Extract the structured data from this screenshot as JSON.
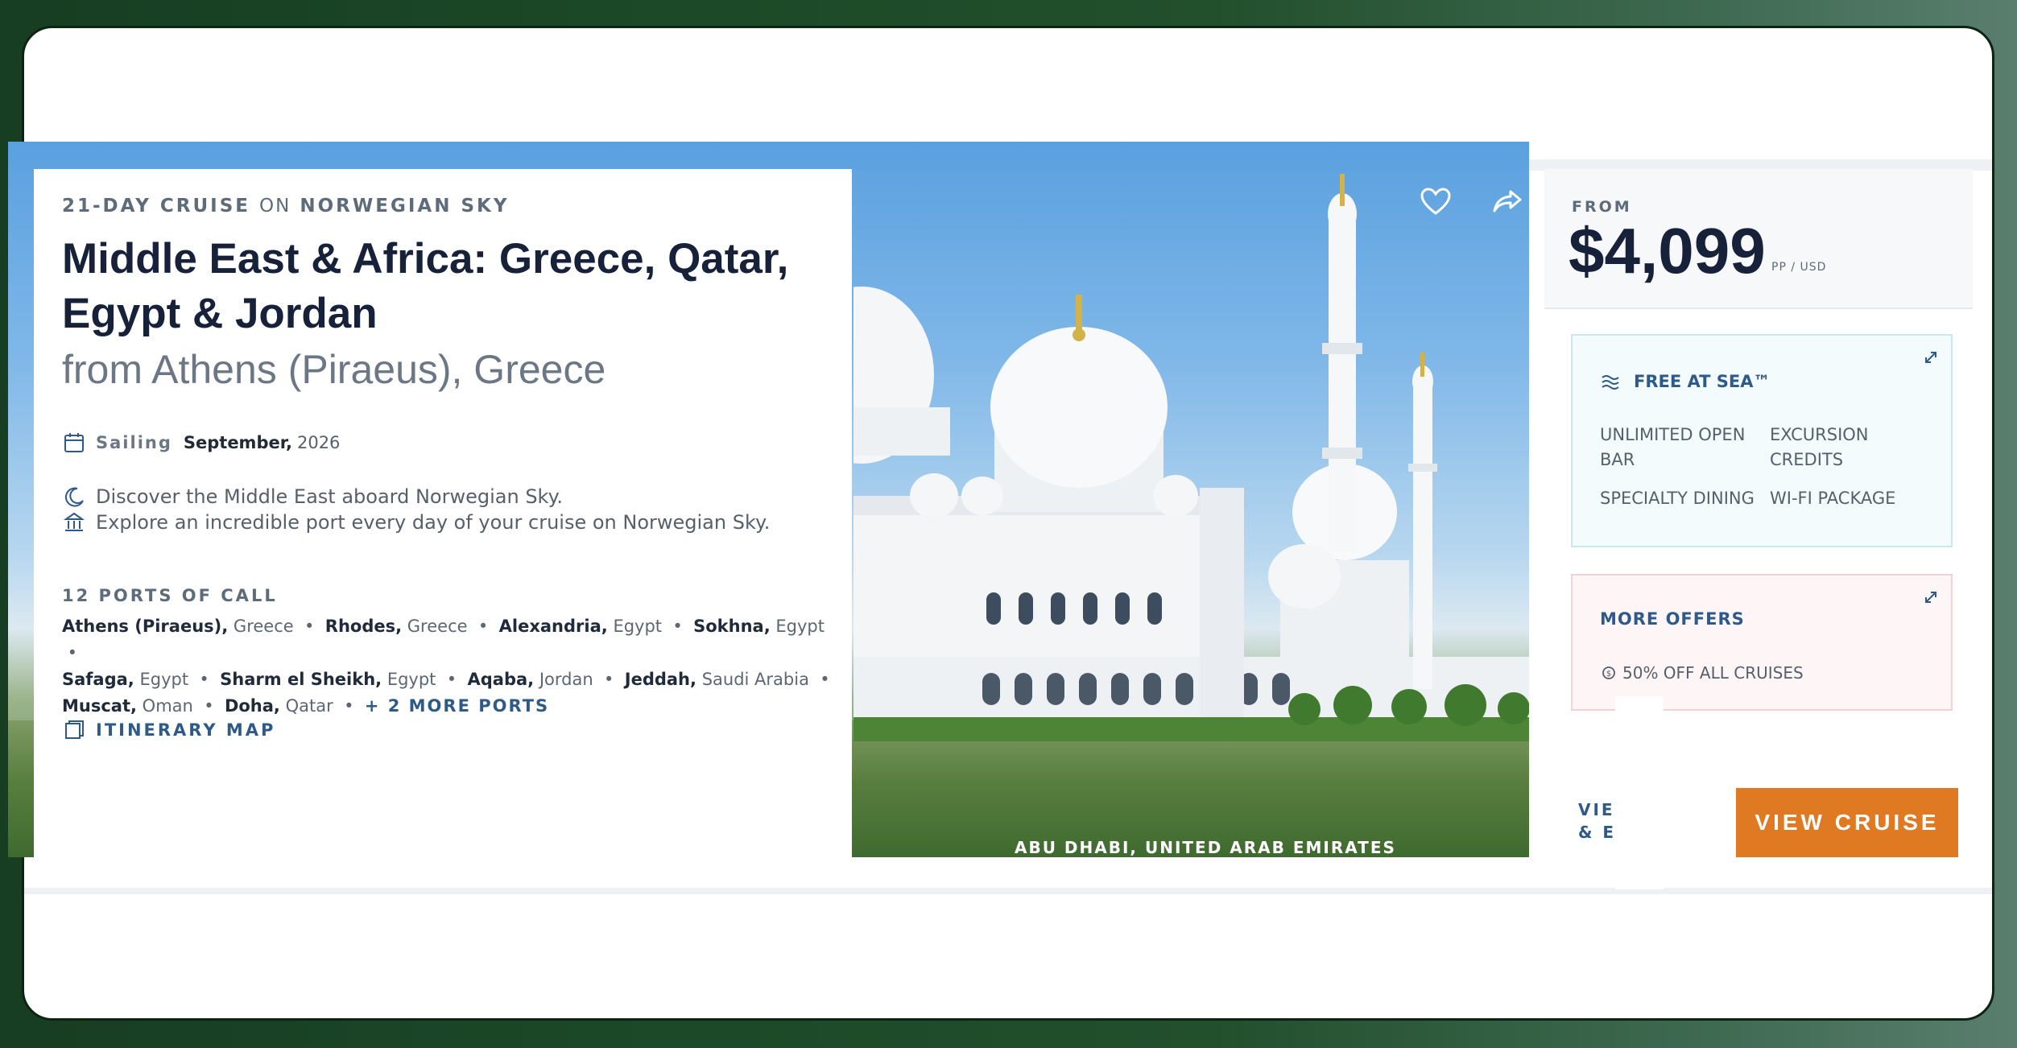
{
  "cruise": {
    "eyebrow_duration": "21-DAY CRUISE",
    "eyebrow_on": "ON",
    "eyebrow_ship": "NORWEGIAN SKY",
    "title": "Middle East & Africa: Greece, Qatar, Egypt & Jordan",
    "subtitle": "from Athens (Piraeus), Greece",
    "sailing_label": "Sailing",
    "sailing_month": "September,",
    "sailing_year": "2026",
    "features": [
      "Discover the Middle East aboard Norwegian Sky.",
      "Explore an incredible port every day of your cruise on Norwegian Sky."
    ],
    "ports_heading": "12 PORTS OF CALL",
    "ports": [
      {
        "city": "Athens (Piraeus),",
        "country": "Greece"
      },
      {
        "city": "Rhodes,",
        "country": "Greece"
      },
      {
        "city": "Alexandria,",
        "country": "Egypt"
      },
      {
        "city": "Sokhna,",
        "country": "Egypt"
      },
      {
        "city": "Safaga,",
        "country": "Egypt"
      },
      {
        "city": "Sharm el Sheikh,",
        "country": "Egypt"
      },
      {
        "city": "Aqaba,",
        "country": "Jordan"
      },
      {
        "city": "Jeddah,",
        "country": "Saudi Arabia"
      },
      {
        "city": "Muscat,",
        "country": "Oman"
      },
      {
        "city": "Doha,",
        "country": "Qatar"
      }
    ],
    "more_ports": "+ 2 MORE PORTS",
    "itinerary_label": "ITINERARY MAP",
    "image_caption": "ABU DHABI, UNITED ARAB EMIRATES"
  },
  "pricing": {
    "from_label": "FROM",
    "price": "$4,099",
    "per_person": "PP / USD"
  },
  "free_at_sea": {
    "title": "FREE AT SEA™",
    "items": [
      "UNLIMITED OPEN",
      "BAR",
      "EXCURSION",
      "CREDITS",
      "SPECIALTY DINING",
      "WI-FI PACKAGE"
    ]
  },
  "offers": {
    "title": "MORE OFFERS",
    "item": "50% OFF ALL CRUISES"
  },
  "actions": {
    "dates_line1": "VIE    TES",
    "dates_line2": "&      ES",
    "view_cruise": "VIEW CRUISE"
  },
  "colors": {
    "accent_orange": "#e07a22",
    "link_blue": "#2e5a8a",
    "navy_text": "#17223a"
  }
}
